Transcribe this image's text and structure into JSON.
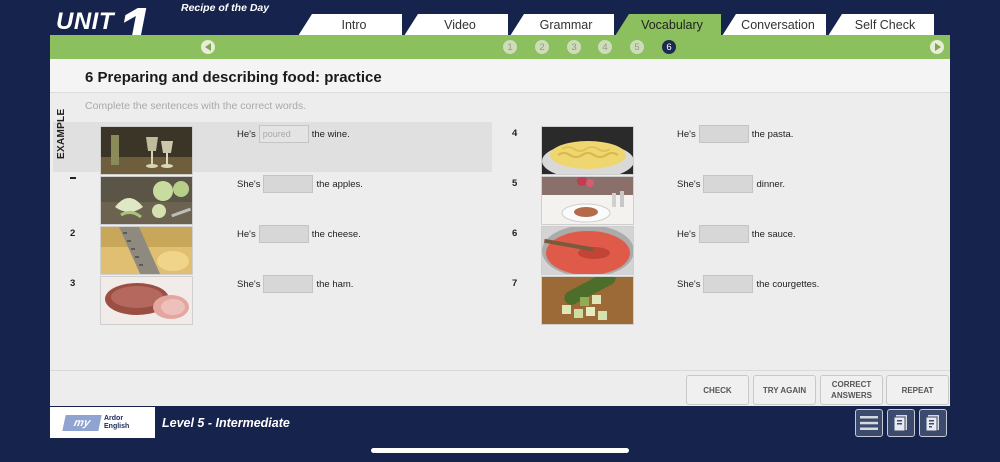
{
  "header": {
    "unit_label": "UNIT",
    "unit_number": "1",
    "subtitle": "Recipe of the Day"
  },
  "tabs": [
    {
      "label": "Intro",
      "active": false
    },
    {
      "label": "Video",
      "active": false
    },
    {
      "label": "Grammar",
      "active": false
    },
    {
      "label": "Vocabulary",
      "active": true
    },
    {
      "label": "Conversation",
      "active": false
    },
    {
      "label": "Self Check",
      "active": false
    }
  ],
  "steps": [
    "1",
    "2",
    "3",
    "4",
    "5",
    "6"
  ],
  "active_step": "6",
  "exercise": {
    "title": "6 Preparing and describing food: practice",
    "instruction": "Complete the sentences with the correct words.",
    "example_label": "EXAMPLE",
    "items_left": [
      {
        "number": "",
        "before": "He's",
        "answer": "poured",
        "after": "the wine."
      },
      {
        "number": "",
        "before": "She's",
        "answer": "",
        "after": "the apples."
      },
      {
        "number": "2",
        "before": "He's",
        "answer": "",
        "after": "the cheese."
      },
      {
        "number": "3",
        "before": "She's",
        "answer": "",
        "after": "the ham."
      }
    ],
    "items_right": [
      {
        "number": "4",
        "before": "He's",
        "answer": "",
        "after": "the pasta."
      },
      {
        "number": "5",
        "before": "She's",
        "answer": "",
        "after": "dinner."
      },
      {
        "number": "6",
        "before": "He's",
        "answer": "",
        "after": "the sauce."
      },
      {
        "number": "7",
        "before": "She's",
        "answer": "",
        "after": "the courgettes."
      }
    ]
  },
  "buttons": {
    "check": "CHECK",
    "try_again": "TRY AGAIN",
    "correct_line1": "CORRECT",
    "correct_line2": "ANSWERS",
    "repeat": "REPEAT"
  },
  "footer": {
    "logo_mark": "my",
    "logo_line1": "Ardor",
    "logo_line2": "English",
    "level": "Level 5 - Intermediate"
  },
  "colors": {
    "background": "#16234c",
    "accent_green": "#8cbf5e",
    "active_step": "#1d2a52"
  }
}
